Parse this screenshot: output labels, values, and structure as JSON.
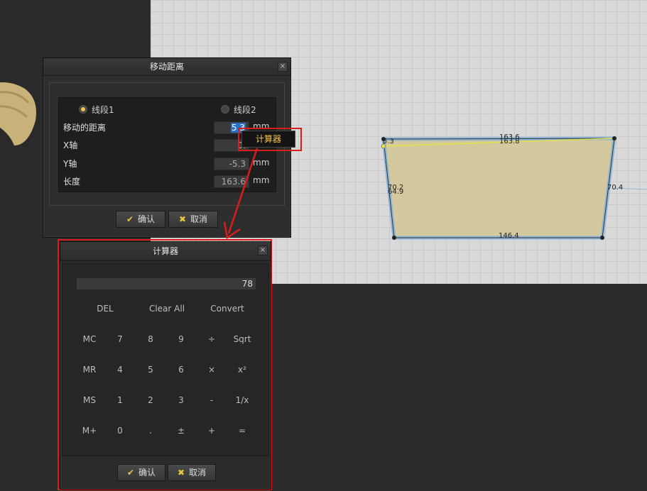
{
  "move_dialog": {
    "title": "移动距离",
    "close": "×",
    "radio1": "线段1",
    "radio2": "线段2",
    "rows": [
      {
        "label": "移动的距离",
        "value": "5.3",
        "unit": "mm"
      },
      {
        "label": "X轴",
        "value": "0.",
        "unit": ""
      },
      {
        "label": "Y轴",
        "value": "-5.3",
        "unit": "mm"
      },
      {
        "label": "长度",
        "value": "163.6",
        "unit": "mm"
      }
    ],
    "ok": "确认",
    "cancel": "取消",
    "calc_button": "计算器"
  },
  "calc_dialog": {
    "title": "计算器",
    "close": "×",
    "display": "78",
    "top_keys": [
      "DEL",
      "Clear All",
      "Convert"
    ],
    "keys": [
      [
        "MC",
        "7",
        "8",
        "9",
        "÷",
        "Sqrt"
      ],
      [
        "MR",
        "4",
        "5",
        "6",
        "×",
        "x²"
      ],
      [
        "MS",
        "1",
        "2",
        "3",
        "-",
        "1/x"
      ],
      [
        "M+",
        "0",
        ".",
        "±",
        "+",
        "="
      ]
    ],
    "ok": "确认",
    "cancel": "取消"
  },
  "pattern": {
    "top_a": "163.6",
    "top_b": "163.8",
    "left_a": "70.2",
    "left_b": "64.9",
    "right": "70.4",
    "bottom": "146.4",
    "corner": "5.3"
  },
  "colors": {
    "highlight": "#d81d1d",
    "accent": "#f3c24a",
    "field_active": "#2a6fc7"
  }
}
